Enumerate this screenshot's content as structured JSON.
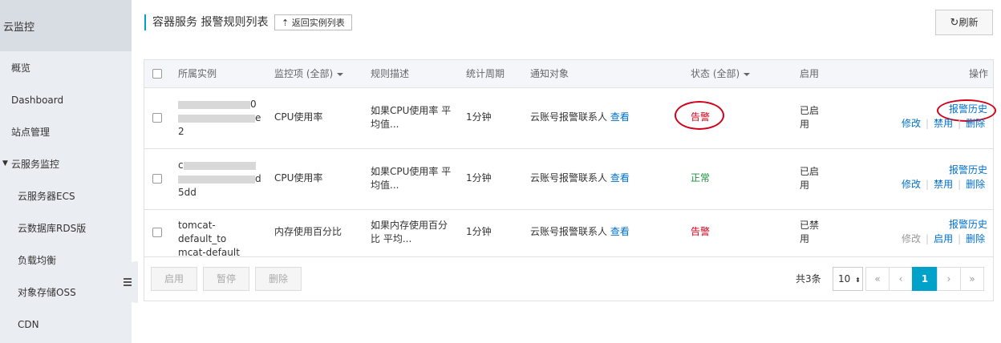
{
  "sidebar": {
    "title": "云监控",
    "items": [
      {
        "label": "概览"
      },
      {
        "label": "Dashboard"
      },
      {
        "label": "站点管理"
      },
      {
        "label": "云服务监控",
        "expanded": true
      },
      {
        "label": "云服务器ECS"
      },
      {
        "label": "云数据库RDS版"
      },
      {
        "label": "负载均衡"
      },
      {
        "label": "对象存储OSS"
      },
      {
        "label": "CDN"
      }
    ]
  },
  "header": {
    "title": "容器服务 报警规则列表",
    "back_label": "返回实例列表",
    "refresh_label": "刷新"
  },
  "table": {
    "columns": {
      "instance": "所属实例",
      "metric": "监控项 (全部)",
      "rule": "规则描述",
      "period": "统计周期",
      "notify": "通知对象",
      "status": "状态 (全部)",
      "enabled": "启用",
      "actions": "操作"
    },
    "rows": [
      {
        "instance_lines": [
          "0",
          "e",
          "2"
        ],
        "metric": "CPU使用率",
        "rule": "如果CPU使用率 平均值...",
        "period": "1分钟",
        "notify": "云账号报警联系人",
        "notify_link": "查看",
        "status": "告警",
        "enabled": "已启用",
        "history": "报警历史",
        "edit": "修改",
        "toggle": "禁用",
        "delete": "删除"
      },
      {
        "instance_lines": [
          "c",
          "d",
          "5dd"
        ],
        "metric": "CPU使用率",
        "rule": "如果CPU使用率 平均值...",
        "period": "1分钟",
        "notify": "云账号报警联系人",
        "notify_link": "查看",
        "status": "正常",
        "enabled": "已启用",
        "history": "报警历史",
        "edit": "修改",
        "toggle": "禁用",
        "delete": "删除"
      },
      {
        "instance_lines": [
          "tomcat-default_to",
          "mcat-default"
        ],
        "metric": "内存使用百分比",
        "rule": "如果内存使用百分比 平均...",
        "period": "1分钟",
        "notify": "云账号报警联系人",
        "notify_link": "查看",
        "status": "告警",
        "enabled": "已禁用",
        "history": "报警历史",
        "edit": "修改",
        "toggle": "启用",
        "delete": "删除"
      }
    ]
  },
  "footer": {
    "enable_label": "启用",
    "pause_label": "暂停",
    "delete_label": "删除",
    "total": "共3条",
    "page_size": "10",
    "pager": {
      "first": "«",
      "prev": "‹",
      "current": "1",
      "next": "›",
      "last": "»"
    }
  },
  "colors": {
    "accent": "#00a2ca",
    "link": "#0070cc",
    "alarm": "#d0021b",
    "ok": "#1e8e3e"
  }
}
